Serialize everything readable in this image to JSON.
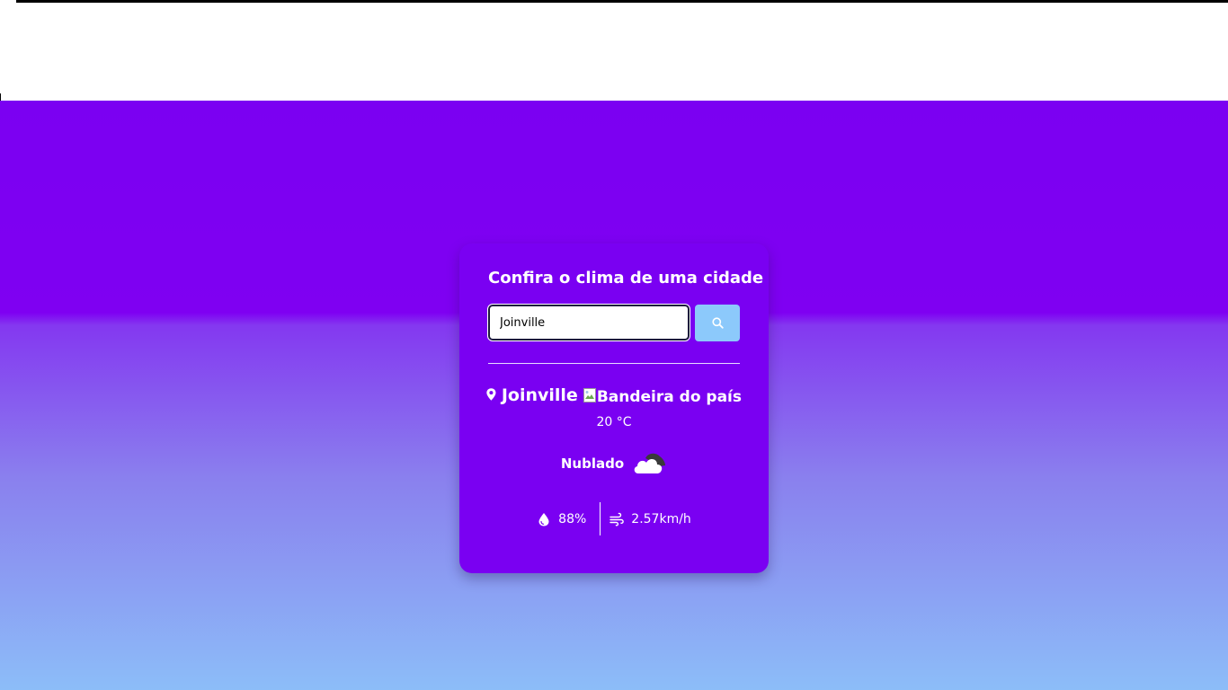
{
  "card": {
    "title": "Confira o clima de uma cidade"
  },
  "search": {
    "value": "Joinville",
    "button_icon": "search-icon"
  },
  "weather": {
    "city": "Joinville",
    "flag_alt": "Bandeira do país",
    "temperature": "20 °C",
    "description": "Nublado",
    "description_icon": "cloud-icon",
    "humidity": "88%",
    "humidity_icon": "droplet-icon",
    "wind": "2.57km/h",
    "wind_icon": "wind-icon"
  },
  "colors": {
    "card_background": "#7a00f2",
    "search_button": "#8cc9fb",
    "gradient_top": "#7b00f2",
    "gradient_bottom": "#8cbdf8",
    "text": "#ffffff"
  }
}
